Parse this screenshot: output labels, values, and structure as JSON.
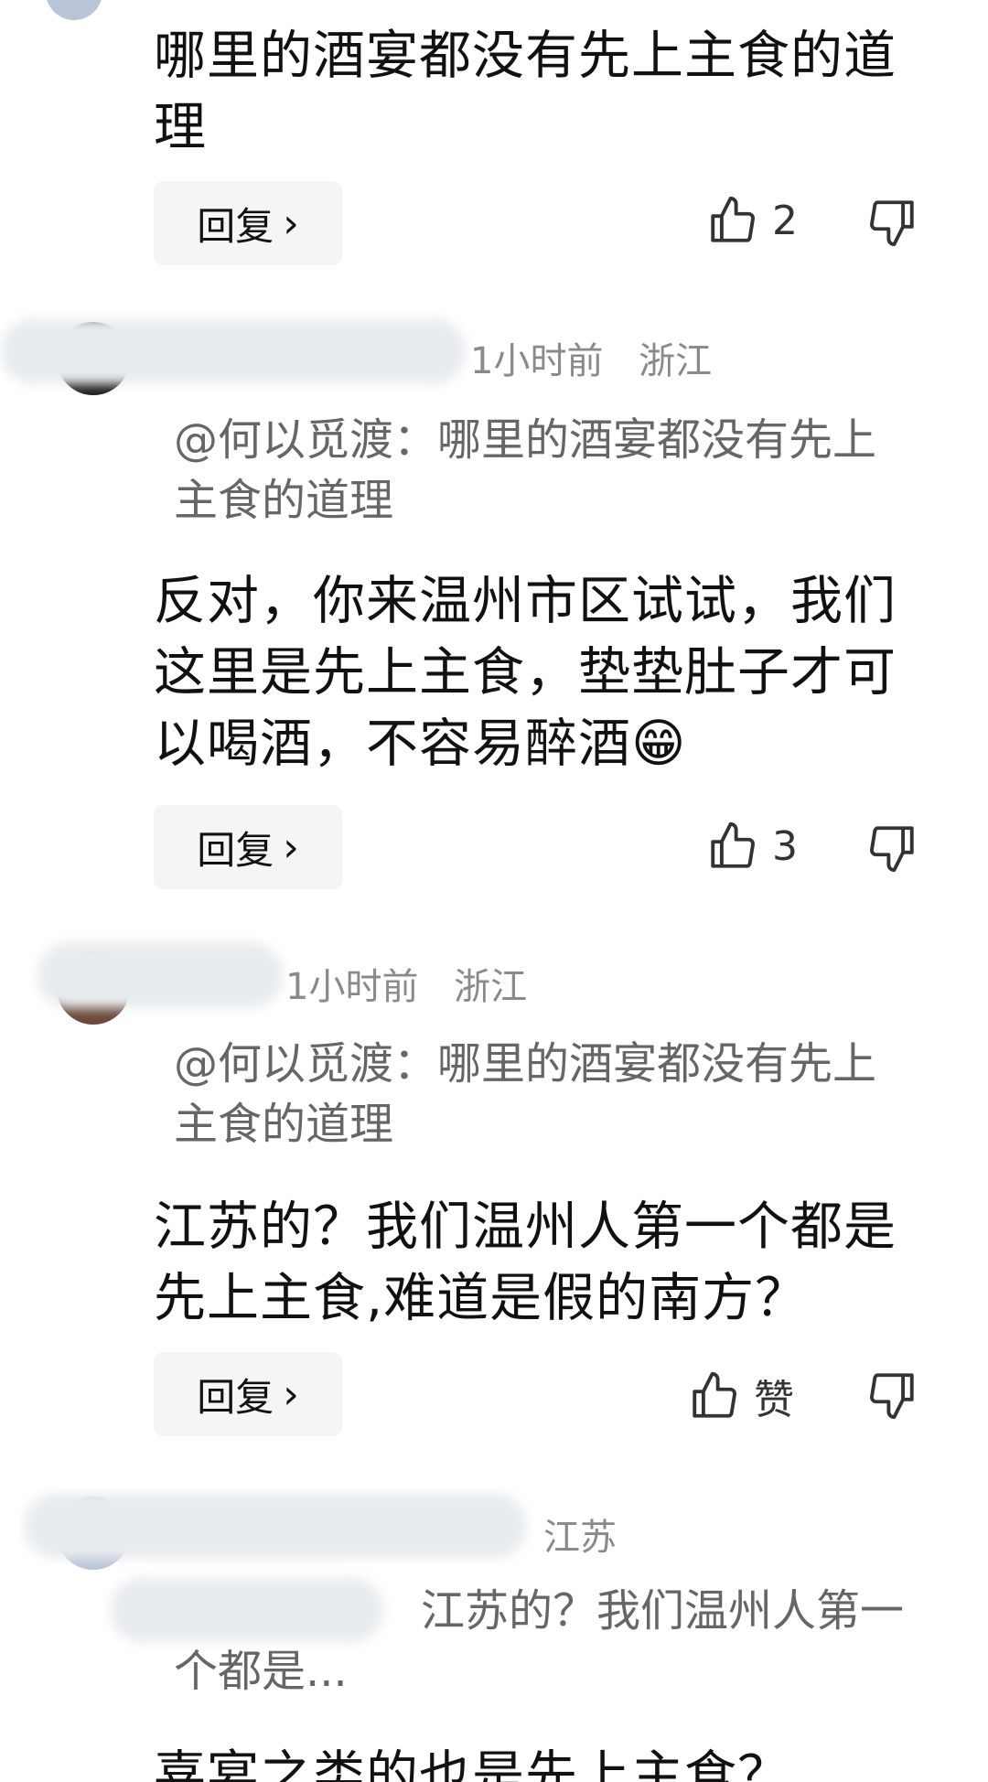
{
  "comments": [
    {
      "text": "哪里的酒宴都没有先上主食的道理",
      "reply_label": "回复",
      "likes": "2"
    },
    {
      "time": "1小时前",
      "region": "浙江",
      "quote": "@何以觅渡：哪里的酒宴都没有先上主食的道理",
      "text": "反对，你来温州市区试试，我们这里是先上主食，垫垫肚子才可以喝酒，不容易醉酒😁",
      "reply_label": "回复",
      "likes": "3"
    },
    {
      "time": "1小时前",
      "region": "浙江",
      "quote": "@何以觅渡：哪里的酒宴都没有先上主食的道理",
      "text": "江苏的？我们温州人第一个都是先上主食,难道是假的南方？",
      "reply_label": "回复",
      "likes": "赞"
    },
    {
      "region": "江苏",
      "quote": "江苏的？我们温州人第一个都是...",
      "text": "喜宴之类的也是先上主食？"
    }
  ],
  "icons": {
    "like": "thumbs-up-icon",
    "dislike": "thumbs-down-icon",
    "chevron": "chevron-right-icon"
  }
}
